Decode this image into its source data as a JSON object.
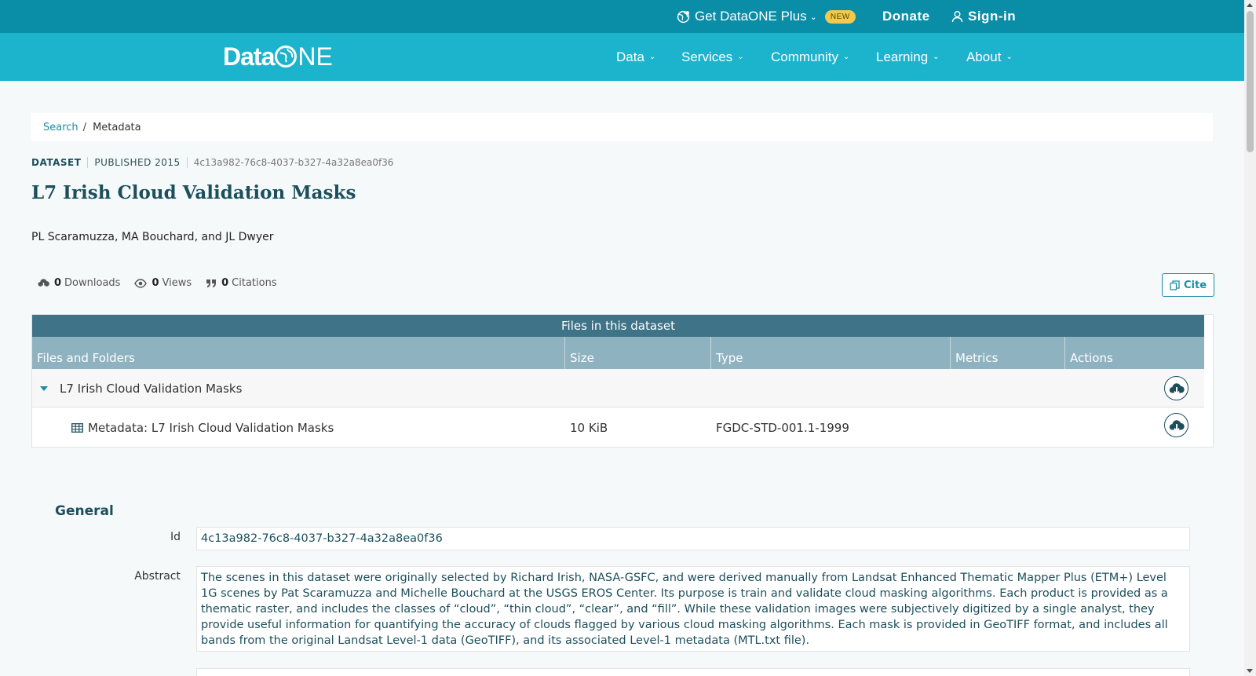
{
  "topbar": {
    "plus_label": "Get DataONE Plus",
    "new_badge": "NEW",
    "donate": "Donate",
    "signin": "Sign-in"
  },
  "nav": {
    "logo_data": "Data",
    "logo_one": "NE",
    "items": [
      "Data",
      "Services",
      "Community",
      "Learning",
      "About"
    ]
  },
  "breadcrumb": {
    "search": "Search",
    "sep": "/",
    "current": "Metadata"
  },
  "dataset": {
    "type": "DATASET",
    "published": "PUBLISHED 2015",
    "pid": "4c13a982-76c8-4037-b327-4a32a8ea0f36",
    "title": "L7 Irish Cloud Validation Masks",
    "authors": "PL Scaramuzza, MA Bouchard, and JL Dwyer"
  },
  "metrics": {
    "downloads_count": "0",
    "downloads_label": "Downloads",
    "views_count": "0",
    "views_label": "Views",
    "citations_count": "0",
    "citations_label": "Citations"
  },
  "cite_button": "Cite",
  "files": {
    "caption": "Files in this dataset",
    "headers": [
      "Files and Folders",
      "Size",
      "Type",
      "Metrics",
      "Actions"
    ],
    "folder_name": "L7 Irish Cloud Validation Masks",
    "file": {
      "name": "Metadata: L7 Irish Cloud Validation Masks",
      "size": "10 KiB",
      "type": "FGDC-STD-001.1-1999"
    }
  },
  "general": {
    "title": "General",
    "id_label": "Id",
    "id_value": "4c13a982-76c8-4037-b327-4a32a8ea0f36",
    "abstract_label": "Abstract",
    "abstract_value": "The scenes in this dataset were originally selected by Richard Irish, NASA-GSFC, and were derived manually from Landsat Enhanced Thematic Mapper Plus (ETM+) Level 1G scenes by Pat Scaramuzza and Michelle Bouchard at the USGS EROS Center. Its purpose is train and validate cloud masking algorithms. Each product is provided as a thematic raster, and includes the classes of “cloud”, “thin cloud”, “clear”, and “fill”. While these validation images were subjectively digitized by a single analyst, they provide useful information for quantifying the accuracy of clouds flagged by various cloud masking algorithms. Each mask is provided in GeoTIFF format, and includes all bands from the original Landsat Level-1 data (GeoTIFF), and its associated Level-1 metadata (MTL.txt file)."
  },
  "colors": {
    "topbar": "#0a8ea8",
    "nav": "#1cb4cc",
    "accent": "#1a8ca6",
    "heading": "#1b4f5c",
    "table_caption": "#3f7387",
    "table_header": "#8fb2c0"
  }
}
